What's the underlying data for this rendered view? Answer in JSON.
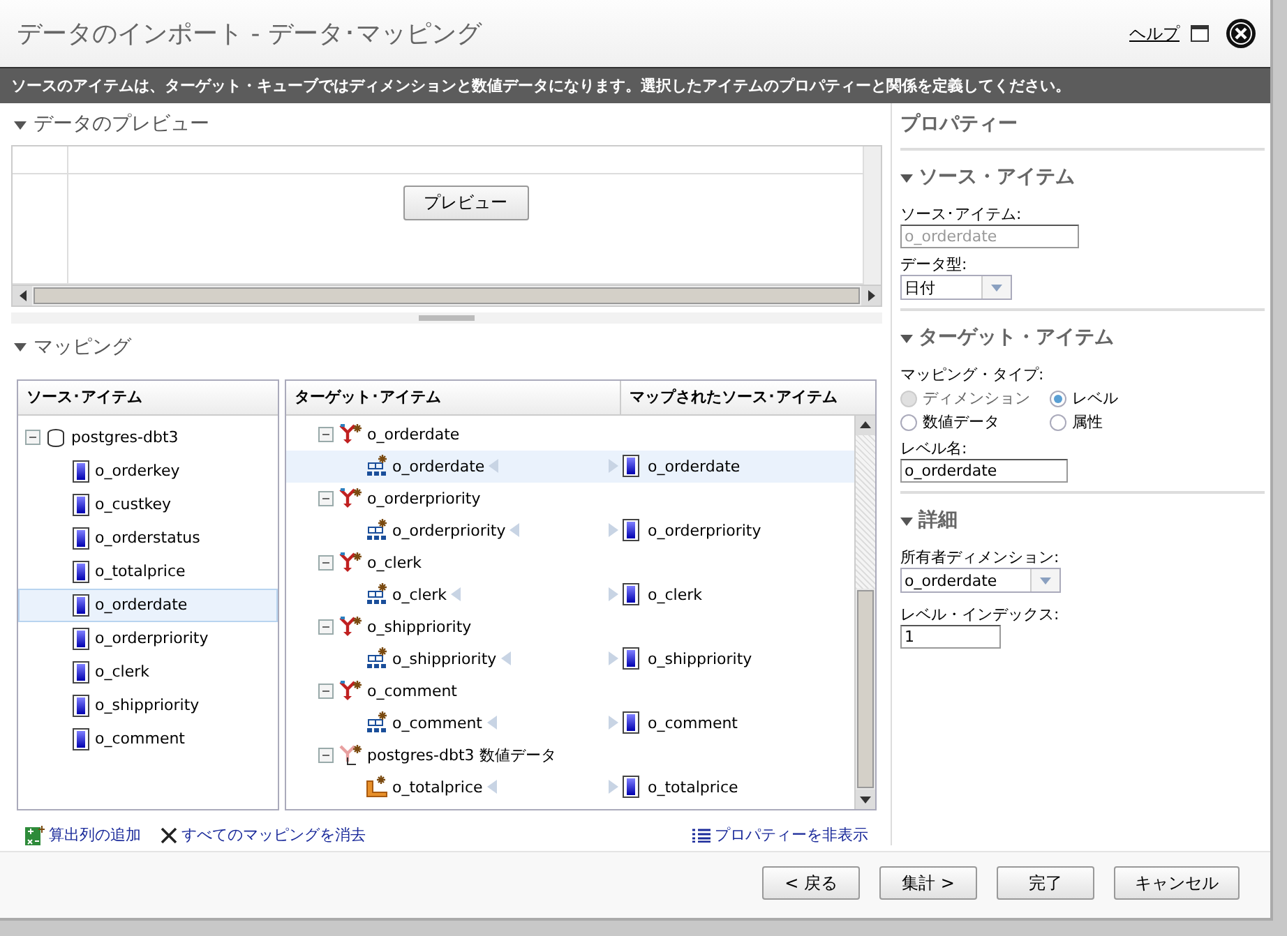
{
  "window": {
    "title": "データのインポート - データ･マッピング",
    "help_link": "ヘルプ"
  },
  "banner": "ソースのアイテムは、ターゲット・キューブではディメンションと数値データになります。選択したアイテムのプロパティーと関係を定義してください。",
  "preview": {
    "heading": "データのプレビュー",
    "expanded": true,
    "button": "プレビュー"
  },
  "mapping": {
    "heading": "マッピング",
    "expanded": true,
    "source": {
      "column": "ソース･アイテム",
      "root": {
        "label": "postgres-dbt3",
        "expanded": true,
        "children": [
          {
            "label": "o_orderkey",
            "selected": false
          },
          {
            "label": "o_custkey",
            "selected": false
          },
          {
            "label": "o_orderstatus",
            "selected": false
          },
          {
            "label": "o_totalprice",
            "selected": false
          },
          {
            "label": "o_orderdate",
            "selected": true
          },
          {
            "label": "o_orderpriority",
            "selected": false
          },
          {
            "label": "o_clerk",
            "selected": false
          },
          {
            "label": "o_shippriority",
            "selected": false
          },
          {
            "label": "o_comment",
            "selected": false
          }
        ]
      }
    },
    "target": {
      "columns": [
        "ターゲット･アイテム",
        "マップされたソース･アイテム"
      ],
      "groups": [
        {
          "kind": "dimension",
          "label": "o_orderdate",
          "expanded": true,
          "children": [
            {
              "kind": "level",
              "label": "o_orderdate",
              "mapped": "o_orderdate",
              "selected": true
            }
          ]
        },
        {
          "kind": "dimension",
          "label": "o_orderpriority",
          "expanded": true,
          "children": [
            {
              "kind": "level",
              "label": "o_orderpriority",
              "mapped": "o_orderpriority",
              "selected": false
            }
          ]
        },
        {
          "kind": "dimension",
          "label": "o_clerk",
          "expanded": true,
          "children": [
            {
              "kind": "level",
              "label": "o_clerk",
              "mapped": "o_clerk",
              "selected": false
            }
          ]
        },
        {
          "kind": "dimension",
          "label": "o_shippriority",
          "expanded": true,
          "children": [
            {
              "kind": "level",
              "label": "o_shippriority",
              "mapped": "o_shippriority",
              "selected": false
            }
          ]
        },
        {
          "kind": "dimension",
          "label": "o_comment",
          "expanded": true,
          "children": [
            {
              "kind": "level",
              "label": "o_comment",
              "mapped": "o_comment",
              "selected": false
            }
          ]
        },
        {
          "kind": "measures",
          "label": "postgres-dbt3 数値データ",
          "expanded": true,
          "children": [
            {
              "kind": "measure",
              "label": "o_totalprice",
              "mapped": "o_totalprice",
              "selected": false
            }
          ]
        }
      ]
    },
    "actions": [
      {
        "kind": "add",
        "label": "算出列の追加"
      },
      {
        "kind": "clear",
        "label": "すべてのマッピングを消去"
      }
    ],
    "hide_properties": "プロパティーを非表示"
  },
  "properties": {
    "title": "プロパティー",
    "source_item": {
      "heading": "ソース・アイテム",
      "expanded": true,
      "item_label": "ソース･アイテム:",
      "item_value": "o_orderdate",
      "type_label": "データ型:",
      "type_value": "日付"
    },
    "target_item": {
      "heading": "ターゲット・アイテム",
      "expanded": true,
      "type_label": "マッピング・タイプ:",
      "types": [
        {
          "label": "ディメンション",
          "selected": false,
          "disabled": true
        },
        {
          "label": "レベル",
          "selected": true,
          "disabled": false
        },
        {
          "label": "数値データ",
          "selected": false,
          "disabled": false
        },
        {
          "label": "属性",
          "selected": false,
          "disabled": false
        }
      ],
      "name_label": "レベル名:",
      "name_value": "o_orderdate"
    },
    "details": {
      "heading": "詳細",
      "expanded": true,
      "owner_label": "所有者ディメンション:",
      "owner_value": "o_orderdate",
      "index_label": "レベル・インデックス:",
      "index_value": "1"
    }
  },
  "buttons": [
    "< 戻る",
    "集計 >",
    "完了",
    "キャンセル"
  ]
}
